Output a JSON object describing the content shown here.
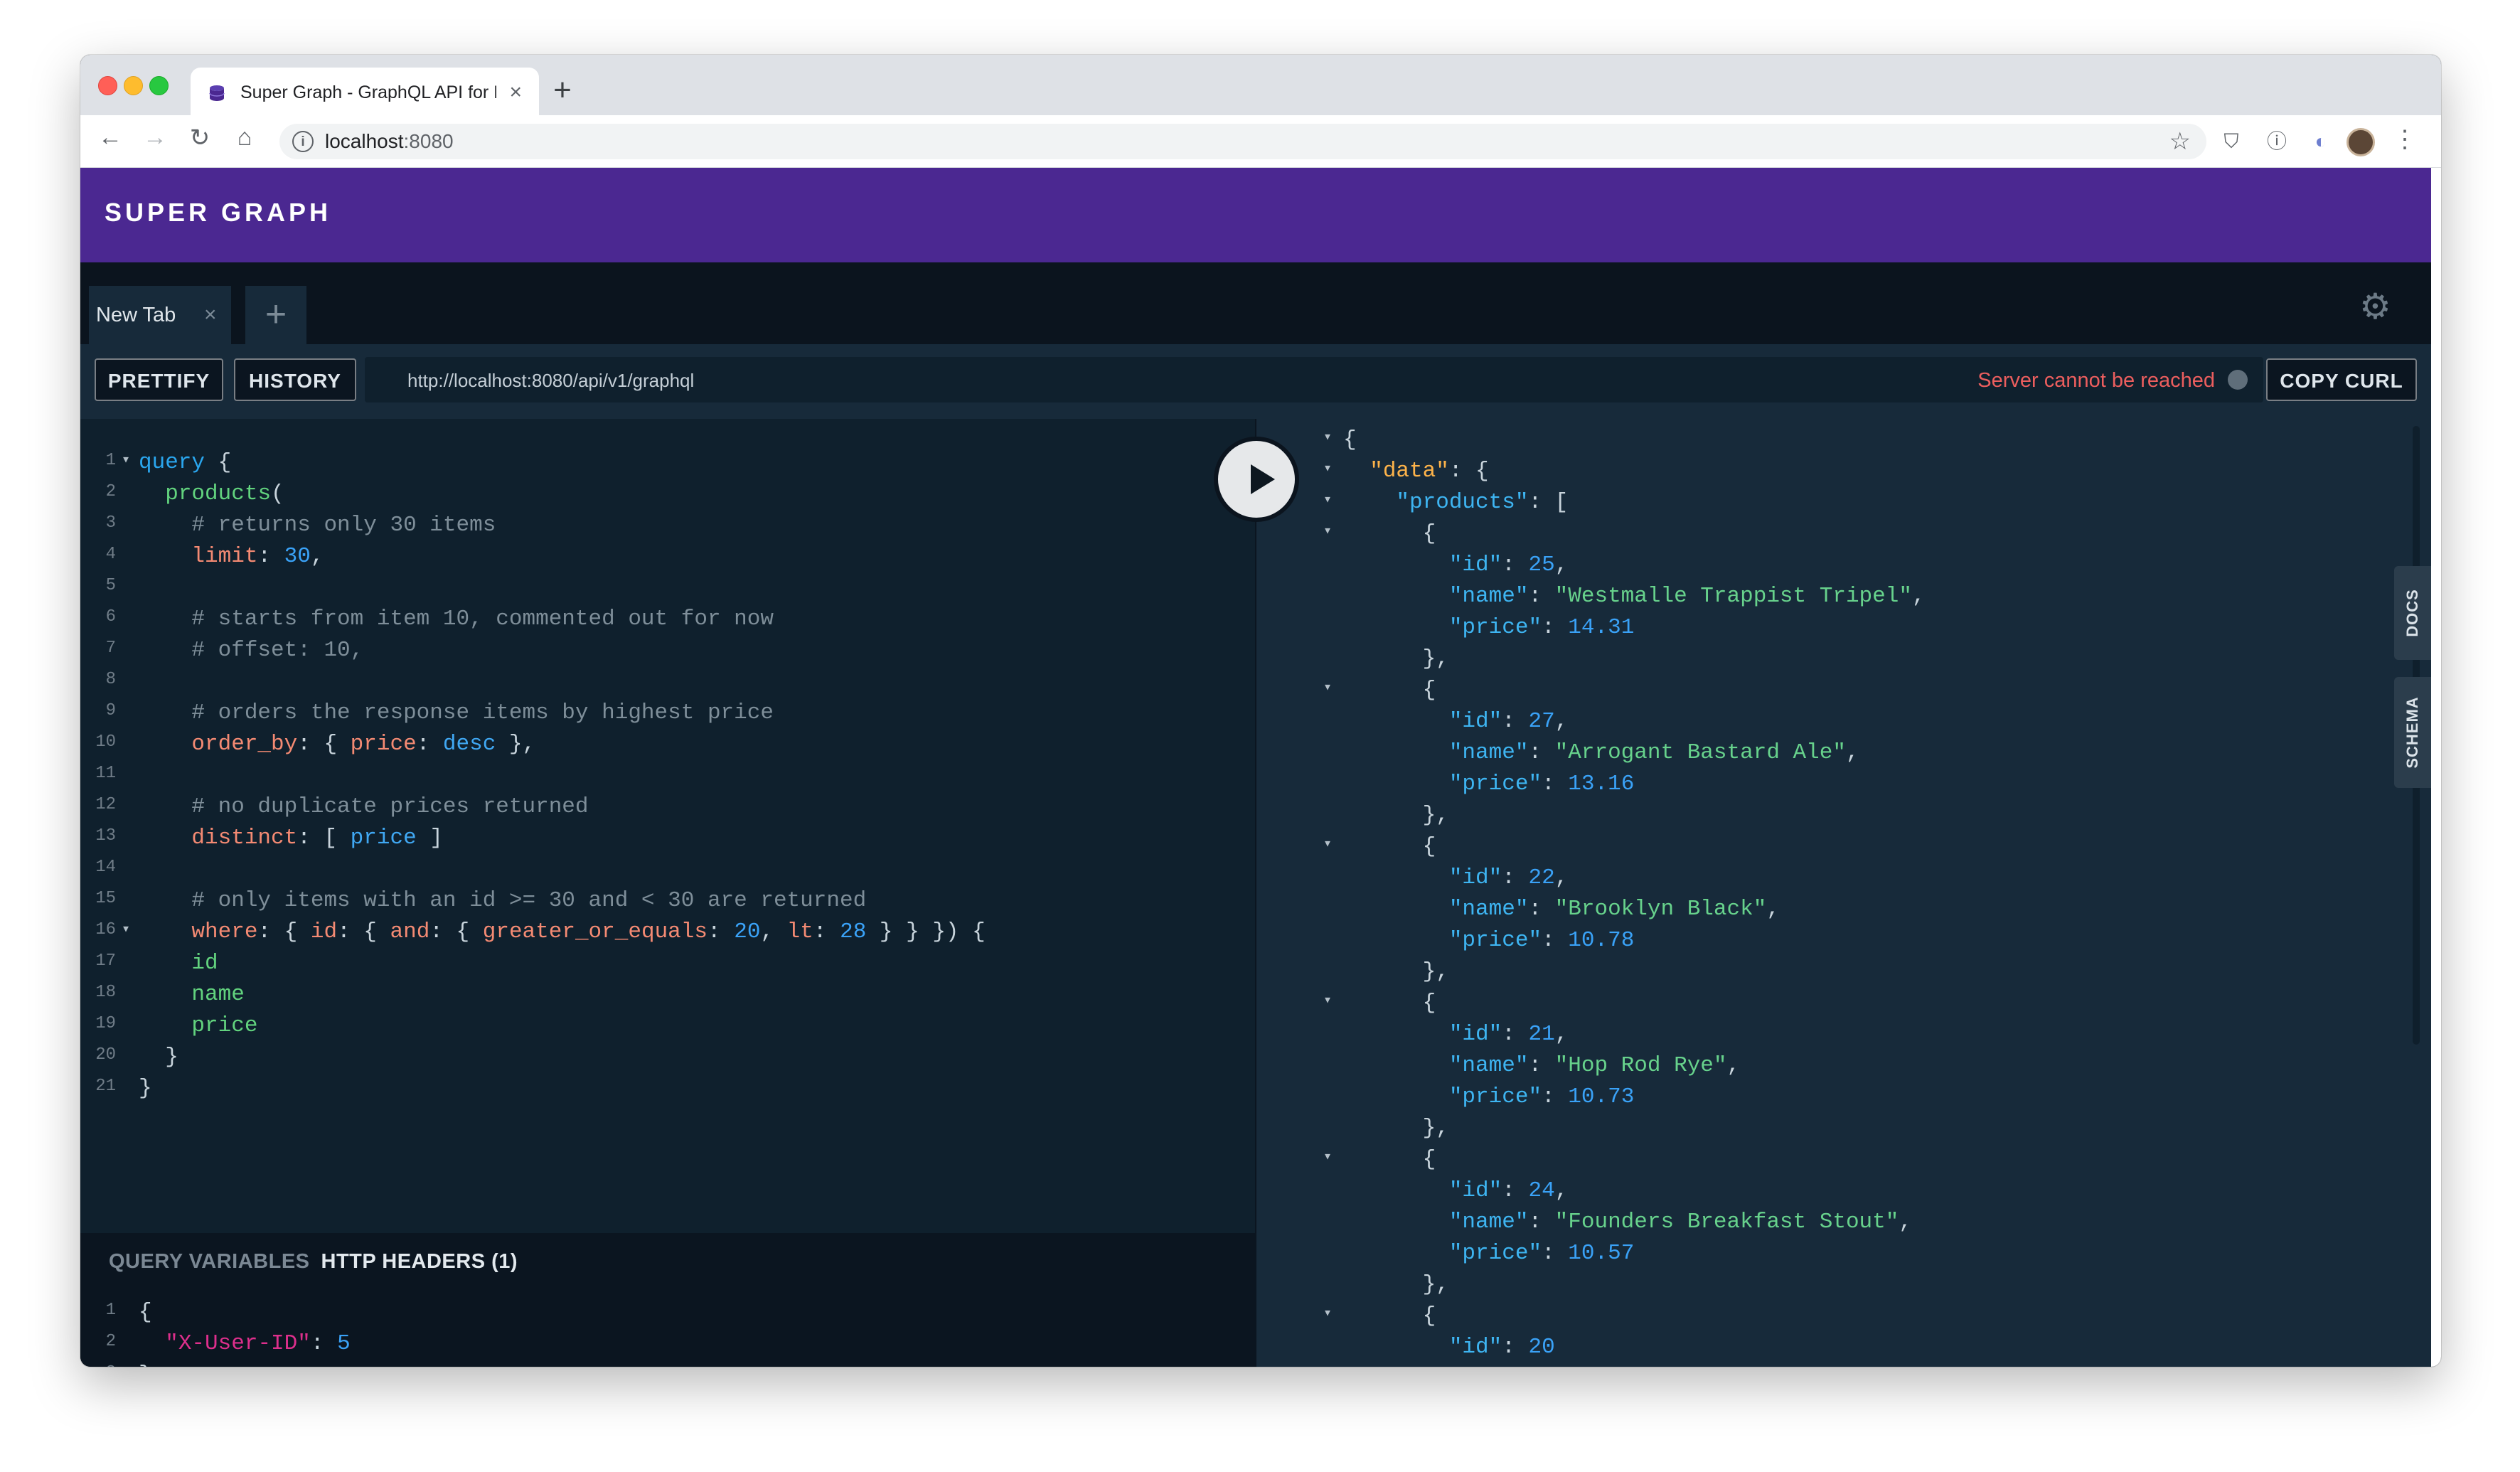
{
  "browser": {
    "tab_title": "Super Graph - GraphQL API for Rails",
    "new_tab_symbol": "+",
    "url_host": "localhost",
    "url_port": ":8080"
  },
  "app": {
    "brand": "SUPER GRAPH",
    "tab_label": "New Tab",
    "add_tab_symbol": "+",
    "buttons": {
      "prettify": "PRETTIFY",
      "history": "HISTORY",
      "copy_curl": "COPY CURL"
    },
    "endpoint": "http://localhost:8080/api/v1/graphql",
    "status_text": "Server cannot be reached",
    "status_color": "#ec5e5e",
    "side_tabs": {
      "docs": "DOCS",
      "schema": "SCHEMA"
    },
    "variables_tabs": {
      "query_variables": "QUERY VARIABLES",
      "http_headers": "HTTP HEADERS (1)"
    }
  },
  "query_lines": [
    {
      "n": "1",
      "fold": true,
      "tokens": [
        [
          "kw",
          "query"
        ],
        [
          "p",
          " {"
        ]
      ]
    },
    {
      "n": "2",
      "tokens": [
        [
          "p",
          "  "
        ],
        [
          "fld",
          "products"
        ],
        [
          "p",
          "("
        ]
      ]
    },
    {
      "n": "3",
      "tokens": [
        [
          "p",
          "    "
        ],
        [
          "cmt",
          "# returns only 30 items"
        ]
      ]
    },
    {
      "n": "4",
      "tokens": [
        [
          "p",
          "    "
        ],
        [
          "arg",
          "limit"
        ],
        [
          "p",
          ": "
        ],
        [
          "num",
          "30"
        ],
        [
          "p",
          ","
        ]
      ]
    },
    {
      "n": "5",
      "tokens": []
    },
    {
      "n": "6",
      "tokens": [
        [
          "p",
          "    "
        ],
        [
          "cmt",
          "# starts from item 10, commented out for now"
        ]
      ]
    },
    {
      "n": "7",
      "tokens": [
        [
          "p",
          "    "
        ],
        [
          "cmt",
          "# offset: 10,"
        ]
      ]
    },
    {
      "n": "8",
      "tokens": []
    },
    {
      "n": "9",
      "tokens": [
        [
          "p",
          "    "
        ],
        [
          "cmt",
          "# orders the response items by highest price"
        ]
      ]
    },
    {
      "n": "10",
      "tokens": [
        [
          "p",
          "    "
        ],
        [
          "arg",
          "order_by"
        ],
        [
          "p",
          ": { "
        ],
        [
          "arg",
          "price"
        ],
        [
          "p",
          ": "
        ],
        [
          "enum",
          "desc"
        ],
        [
          "p",
          " },"
        ]
      ]
    },
    {
      "n": "11",
      "tokens": []
    },
    {
      "n": "12",
      "tokens": [
        [
          "p",
          "    "
        ],
        [
          "cmt",
          "# no duplicate prices returned"
        ]
      ]
    },
    {
      "n": "13",
      "tokens": [
        [
          "p",
          "    "
        ],
        [
          "arg",
          "distinct"
        ],
        [
          "p",
          ": [ "
        ],
        [
          "enum",
          "price"
        ],
        [
          "p",
          " ]"
        ]
      ]
    },
    {
      "n": "14",
      "tokens": []
    },
    {
      "n": "15",
      "tokens": [
        [
          "p",
          "    "
        ],
        [
          "cmt",
          "# only items with an id >= 30 and < 30 are returned"
        ]
      ]
    },
    {
      "n": "16",
      "fold": true,
      "tokens": [
        [
          "p",
          "    "
        ],
        [
          "arg",
          "where"
        ],
        [
          "p",
          ": { "
        ],
        [
          "arg",
          "id"
        ],
        [
          "p",
          ": { "
        ],
        [
          "arg",
          "and"
        ],
        [
          "p",
          ": { "
        ],
        [
          "arg",
          "greater_or_equals"
        ],
        [
          "p",
          ": "
        ],
        [
          "num",
          "20"
        ],
        [
          "p",
          ", "
        ],
        [
          "arg",
          "lt"
        ],
        [
          "p",
          ": "
        ],
        [
          "num",
          "28"
        ],
        [
          "p",
          " } } }) {"
        ]
      ]
    },
    {
      "n": "17",
      "tokens": [
        [
          "p",
          "    "
        ],
        [
          "fld",
          "id"
        ]
      ]
    },
    {
      "n": "18",
      "tokens": [
        [
          "p",
          "    "
        ],
        [
          "fld",
          "name"
        ]
      ]
    },
    {
      "n": "19",
      "tokens": [
        [
          "p",
          "    "
        ],
        [
          "fld",
          "price"
        ]
      ]
    },
    {
      "n": "20",
      "tokens": [
        [
          "p",
          "  }"
        ]
      ]
    },
    {
      "n": "21",
      "tokens": [
        [
          "p",
          "}"
        ]
      ]
    }
  ],
  "variable_lines": [
    {
      "n": "1",
      "tokens": [
        [
          "p",
          "{"
        ]
      ]
    },
    {
      "n": "2",
      "tokens": [
        [
          "p",
          "  "
        ],
        [
          "var",
          "\"X-User-ID\""
        ],
        [
          "p",
          ": "
        ],
        [
          "num",
          "5"
        ]
      ]
    },
    {
      "n": "3",
      "tokens": [
        [
          "p",
          "}"
        ]
      ]
    }
  ],
  "result_lines": [
    {
      "fold": true,
      "tokens": [
        [
          "p",
          "{"
        ]
      ]
    },
    {
      "fold": true,
      "tokens": [
        [
          "p",
          "  "
        ],
        [
          "data",
          "\"data\""
        ],
        [
          "p",
          ": {"
        ]
      ]
    },
    {
      "fold": true,
      "tokens": [
        [
          "p",
          "    "
        ],
        [
          "key",
          "\"products\""
        ],
        [
          "p",
          ": ["
        ]
      ]
    },
    {
      "fold": true,
      "tokens": [
        [
          "p",
          "      {"
        ]
      ]
    },
    {
      "tokens": [
        [
          "p",
          "        "
        ],
        [
          "key",
          "\"id\""
        ],
        [
          "p",
          ": "
        ],
        [
          "num",
          "25"
        ],
        [
          "p",
          ","
        ]
      ]
    },
    {
      "tokens": [
        [
          "p",
          "        "
        ],
        [
          "key",
          "\"name\""
        ],
        [
          "p",
          ": "
        ],
        [
          "str",
          "\"Westmalle Trappist Tripel\""
        ],
        [
          "p",
          ","
        ]
      ]
    },
    {
      "tokens": [
        [
          "p",
          "        "
        ],
        [
          "key",
          "\"price\""
        ],
        [
          "p",
          ": "
        ],
        [
          "num",
          "14.31"
        ]
      ]
    },
    {
      "tokens": [
        [
          "p",
          "      },"
        ]
      ]
    },
    {
      "fold": true,
      "tokens": [
        [
          "p",
          "      {"
        ]
      ]
    },
    {
      "tokens": [
        [
          "p",
          "        "
        ],
        [
          "key",
          "\"id\""
        ],
        [
          "p",
          ": "
        ],
        [
          "num",
          "27"
        ],
        [
          "p",
          ","
        ]
      ]
    },
    {
      "tokens": [
        [
          "p",
          "        "
        ],
        [
          "key",
          "\"name\""
        ],
        [
          "p",
          ": "
        ],
        [
          "str",
          "\"Arrogant Bastard Ale\""
        ],
        [
          "p",
          ","
        ]
      ]
    },
    {
      "tokens": [
        [
          "p",
          "        "
        ],
        [
          "key",
          "\"price\""
        ],
        [
          "p",
          ": "
        ],
        [
          "num",
          "13.16"
        ]
      ]
    },
    {
      "tokens": [
        [
          "p",
          "      },"
        ]
      ]
    },
    {
      "fold": true,
      "tokens": [
        [
          "p",
          "      {"
        ]
      ]
    },
    {
      "tokens": [
        [
          "p",
          "        "
        ],
        [
          "key",
          "\"id\""
        ],
        [
          "p",
          ": "
        ],
        [
          "num",
          "22"
        ],
        [
          "p",
          ","
        ]
      ]
    },
    {
      "tokens": [
        [
          "p",
          "        "
        ],
        [
          "key",
          "\"name\""
        ],
        [
          "p",
          ": "
        ],
        [
          "str",
          "\"Brooklyn Black\""
        ],
        [
          "p",
          ","
        ]
      ]
    },
    {
      "tokens": [
        [
          "p",
          "        "
        ],
        [
          "key",
          "\"price\""
        ],
        [
          "p",
          ": "
        ],
        [
          "num",
          "10.78"
        ]
      ]
    },
    {
      "tokens": [
        [
          "p",
          "      },"
        ]
      ]
    },
    {
      "fold": true,
      "tokens": [
        [
          "p",
          "      {"
        ]
      ]
    },
    {
      "tokens": [
        [
          "p",
          "        "
        ],
        [
          "key",
          "\"id\""
        ],
        [
          "p",
          ": "
        ],
        [
          "num",
          "21"
        ],
        [
          "p",
          ","
        ]
      ]
    },
    {
      "tokens": [
        [
          "p",
          "        "
        ],
        [
          "key",
          "\"name\""
        ],
        [
          "p",
          ": "
        ],
        [
          "str",
          "\"Hop Rod Rye\""
        ],
        [
          "p",
          ","
        ]
      ]
    },
    {
      "tokens": [
        [
          "p",
          "        "
        ],
        [
          "key",
          "\"price\""
        ],
        [
          "p",
          ": "
        ],
        [
          "num",
          "10.73"
        ]
      ]
    },
    {
      "tokens": [
        [
          "p",
          "      },"
        ]
      ]
    },
    {
      "fold": true,
      "tokens": [
        [
          "p",
          "      {"
        ]
      ]
    },
    {
      "tokens": [
        [
          "p",
          "        "
        ],
        [
          "key",
          "\"id\""
        ],
        [
          "p",
          ": "
        ],
        [
          "num",
          "24"
        ],
        [
          "p",
          ","
        ]
      ]
    },
    {
      "tokens": [
        [
          "p",
          "        "
        ],
        [
          "key",
          "\"name\""
        ],
        [
          "p",
          ": "
        ],
        [
          "str",
          "\"Founders Breakfast Stout\""
        ],
        [
          "p",
          ","
        ]
      ]
    },
    {
      "tokens": [
        [
          "p",
          "        "
        ],
        [
          "key",
          "\"price\""
        ],
        [
          "p",
          ": "
        ],
        [
          "num",
          "10.57"
        ]
      ]
    },
    {
      "tokens": [
        [
          "p",
          "      },"
        ]
      ]
    },
    {
      "fold": true,
      "tokens": [
        [
          "p",
          "      {"
        ]
      ]
    },
    {
      "tokens": [
        [
          "p",
          "        "
        ],
        [
          "key",
          "\"id\""
        ],
        [
          "p",
          ": "
        ],
        [
          "num",
          "20"
        ]
      ]
    }
  ],
  "icons": {
    "back": "arrow-left-icon",
    "forward": "arrow-right-icon",
    "reload": "reload-icon",
    "home": "home-icon",
    "info": "info-icon",
    "star": "star-icon",
    "gear": "gear-icon",
    "play": "play-icon"
  }
}
